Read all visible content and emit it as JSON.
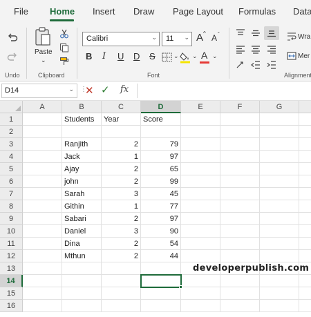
{
  "ribbon_tabs": [
    {
      "label": "File"
    },
    {
      "label": "Home"
    },
    {
      "label": "Insert"
    },
    {
      "label": "Draw"
    },
    {
      "label": "Page Layout"
    },
    {
      "label": "Formulas"
    },
    {
      "label": "Data"
    }
  ],
  "active_tab": "Home",
  "ribbon": {
    "undo_group_label": "Undo",
    "clipboard_group_label": "Clipboard",
    "font_group_label": "Font",
    "alignment_group_label": "Alignment",
    "paste_label": "Paste",
    "font_name": "Calibri",
    "font_size": "11",
    "bold_label": "B",
    "italic_label": "I",
    "underline_label": "U",
    "double_underline_label": "D",
    "strike_label": "S",
    "grow_font_label": "A",
    "shrink_font_label": "A",
    "font_color_label": "A",
    "wrap_text_label": "Wra",
    "merge_label": "Mer"
  },
  "formula_bar": {
    "name_box": "D14",
    "fx_label": "fx",
    "formula": ""
  },
  "sheet": {
    "columns": [
      "A",
      "B",
      "C",
      "D",
      "E",
      "F",
      "G"
    ],
    "selected_column": "D",
    "rows": [
      "1",
      "2",
      "3",
      "4",
      "5",
      "6",
      "7",
      "8",
      "9",
      "10",
      "11",
      "12",
      "13",
      "14",
      "15",
      "16"
    ],
    "selected_row": "14",
    "headers": {
      "students": "Students",
      "year": "Year",
      "score": "Score"
    },
    "records": [
      {
        "student": "Ranjith",
        "year": "2",
        "score": "79"
      },
      {
        "student": "Jack",
        "year": "1",
        "score": "97"
      },
      {
        "student": "Ajay",
        "year": "2",
        "score": "65"
      },
      {
        "student": "john",
        "year": "2",
        "score": "99"
      },
      {
        "student": "Sarah",
        "year": "3",
        "score": "45"
      },
      {
        "student": "Githin",
        "year": "1",
        "score": "77"
      },
      {
        "student": "Sabari",
        "year": "2",
        "score": "97"
      },
      {
        "student": "Daniel",
        "year": "3",
        "score": "90"
      },
      {
        "student": "Dina",
        "year": "2",
        "score": "54"
      },
      {
        "student": "Mthun",
        "year": "2",
        "score": "44"
      }
    ]
  },
  "watermark": "developerpublish.com",
  "colors": {
    "accent": "#1e6b3a",
    "highlight_yellow": "#f5e400",
    "font_color_red": "#e53935"
  }
}
